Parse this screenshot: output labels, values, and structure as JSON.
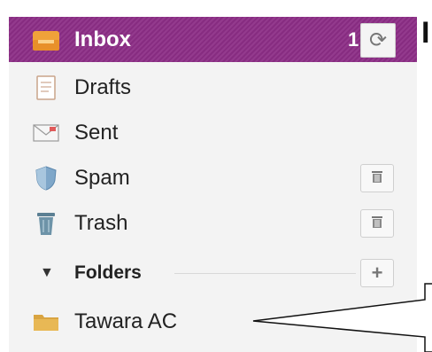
{
  "mail": {
    "inbox": {
      "label": "Inbox",
      "count": "1",
      "icon": "inbox-tray-icon",
      "refresh_icon": "refresh-icon",
      "glyph": "⟳"
    },
    "drafts": {
      "label": "Drafts",
      "icon": "drafts-icon"
    },
    "sent": {
      "label": "Sent",
      "icon": "sent-icon"
    },
    "spam": {
      "label": "Spam",
      "icon": "shield-icon",
      "action_icon": "trash-can-icon"
    },
    "trash": {
      "label": "Trash",
      "icon": "trash-icon",
      "action_icon": "trash-can-icon"
    },
    "folders": {
      "label": "Folders",
      "add_icon": "plus-icon",
      "add_glyph": "+"
    },
    "custom_folders": [
      {
        "label": "Tawara AC",
        "icon": "folder-icon"
      }
    ]
  },
  "colors": {
    "active_bg": "#8c2e86",
    "sidebar_bg": "#f3f3f3"
  },
  "page_edge_letter": "I"
}
